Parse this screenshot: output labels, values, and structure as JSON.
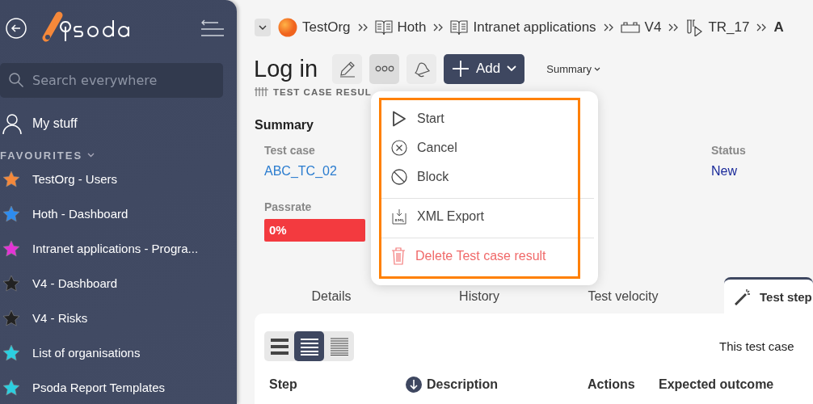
{
  "sidebar": {
    "search": {
      "placeholder": "Search everywhere"
    },
    "my_stuff": "My stuff",
    "favourites_heading": "FAVOURITES",
    "favourites": [
      {
        "label": "TestOrg - Users",
        "color": "#f5883a"
      },
      {
        "label": "Hoth - Dashboard",
        "color": "#2d8cf0"
      },
      {
        "label": "Intranet applications - Progra...",
        "color": "#e433d6"
      },
      {
        "label": "V4 - Dashboard",
        "color": "#222222"
      },
      {
        "label": "V4 - Risks",
        "color": "#222222"
      },
      {
        "label": "List of organisations",
        "color": "#2bcfe0"
      },
      {
        "label": "Psoda Report Templates",
        "color": "#2bcfe0"
      }
    ]
  },
  "breadcrumb": [
    {
      "label": "TestOrg",
      "kind": "org"
    },
    {
      "label": "Hoth",
      "kind": "book"
    },
    {
      "label": "Intranet applications",
      "kind": "book"
    },
    {
      "label": "V4",
      "kind": "release"
    },
    {
      "label": "TR_17",
      "kind": "testrun"
    },
    {
      "label": "A",
      "kind": "plain"
    }
  ],
  "page": {
    "title": "Log in",
    "add_button": "Add",
    "summary_menu": "Summary",
    "subtitle": "TEST CASE RESUL"
  },
  "actions_menu": {
    "groups": [
      [
        {
          "label": "Start",
          "kind": "normal"
        },
        {
          "label": "Cancel",
          "kind": "normal"
        },
        {
          "label": "Block",
          "kind": "normal"
        }
      ],
      [
        {
          "label": "XML Export",
          "kind": "normal"
        }
      ],
      [
        {
          "label": "Delete Test case result",
          "kind": "danger"
        }
      ]
    ]
  },
  "summary": {
    "heading": "Summary",
    "test_case_label": "Test case",
    "test_case_value": "ABC_TC_02",
    "status_label": "Status",
    "status_value": "New",
    "passrate_label": "Passrate",
    "passrate_value": "0%"
  },
  "tabs": [
    {
      "label": "Details",
      "selected": false
    },
    {
      "label": "History",
      "selected": false
    },
    {
      "label": "Test velocity",
      "selected": false
    },
    {
      "label": "Test step",
      "selected": true
    }
  ],
  "view_modes": [
    {
      "selected": false
    },
    {
      "selected": true
    },
    {
      "selected": false
    }
  ],
  "notice": "This test case",
  "table": {
    "columns": [
      "Step",
      "Description",
      "Actions",
      "Expected outcome"
    ]
  }
}
